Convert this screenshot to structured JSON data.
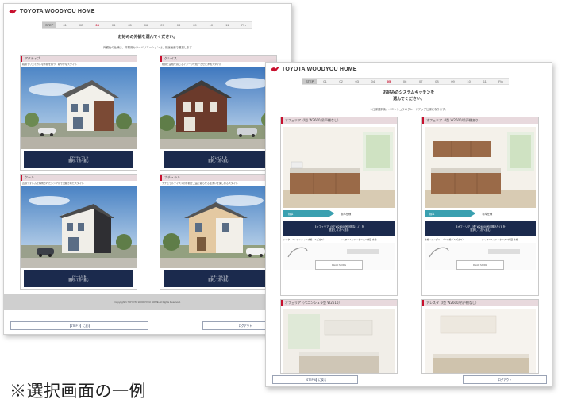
{
  "brand": {
    "name": "TOYOTA WOODYOU HOME",
    "color": "#c8102e"
  },
  "screen_a": {
    "steps": {
      "title": "STEP",
      "items": [
        "01",
        "02",
        "03",
        "04",
        "05",
        "06",
        "07",
        "08",
        "09",
        "10",
        "11",
        "Fin"
      ],
      "current": "03"
    },
    "heading": "お好みの外観を選んでください。",
    "sub": "外観色の仕様は、作業用カラーバリエーションは、別途画面で選択します",
    "cards": [
      {
        "title": "アクティブ",
        "desc": "軽快でリズミカルな外観を持つ、軽やかなスタイル",
        "btn1": "【アクティブ】を",
        "btn2": "選択して次へ進む"
      },
      {
        "title": "グレイス",
        "desc": "格調と品格を感じるイメージを統一させた洋風スタイル",
        "btn1": "【グレイス】を",
        "btn2": "選択して次へ進む"
      },
      {
        "title": "クール",
        "desc": "直線フォルムで構成されたシンプルで洗練されたスタイル",
        "btn1": "【クール】を",
        "btn2": "選択して次へ進む"
      },
      {
        "title": "ナチュラル",
        "desc": "ナチュラルテイストの外観で上品に暮らせる住まいを楽しめるスタイル",
        "btn1": "【ナチュラル】を",
        "btn2": "選択して次へ進む"
      }
    ],
    "footer": "Copyright © TOYOTA WOODYOU HOME All Rights Reserved.",
    "back_button": "【STEP 2】に戻る",
    "logout_button": "ログアウト"
  },
  "screen_b": {
    "steps": {
      "title": "STEP",
      "items": [
        "01",
        "02",
        "03",
        "04",
        "05",
        "06",
        "07",
        "08",
        "09",
        "10",
        "11",
        "Fin"
      ],
      "current": "05"
    },
    "heading_line1": "お好みのシステムキッチンを",
    "heading_line2": "選んでください。",
    "sub": "※仕様選択後、ペニンシュラのグレードアップ仕様になります。",
    "cards": [
      {
        "title": "オフェリア（I型 W2600/吊戸棚なし）",
        "tag": "標準",
        "equip": "標準仕様",
        "btn1": "【オフェリア（I型 W2600/吊戸棚なし）】を",
        "btn2": "選択して次へ進む",
        "spec1": "シンク・ペンシンシャー水栓（ミズガキ）",
        "spec2": "シャワーヘッド・ホース一体型 水栓",
        "more": "READ MORE"
      },
      {
        "title": "オフェリア（I型 W2600/吊戸棚あり）",
        "tag": "標準",
        "equip": "標準仕様",
        "btn1": "【オフェリア（I型 W2600/吊戸棚あり）】を",
        "btn2": "選択して次へ進む",
        "spec1": "水栓・シングルレバー水栓（ミズガキ）",
        "spec2": "シャワーヘッド・ホース一体型 水栓",
        "more": "READ MORE"
      },
      {
        "title": "オフェリア（ペニンシュラ型 W2610）"
      },
      {
        "title": "アレスタ（I型 W2600/吊戸棚なし）"
      }
    ],
    "back_button": "【STEP 4】に戻る",
    "logout_button": "ログアウト"
  },
  "caption": "※選択画面の一例"
}
